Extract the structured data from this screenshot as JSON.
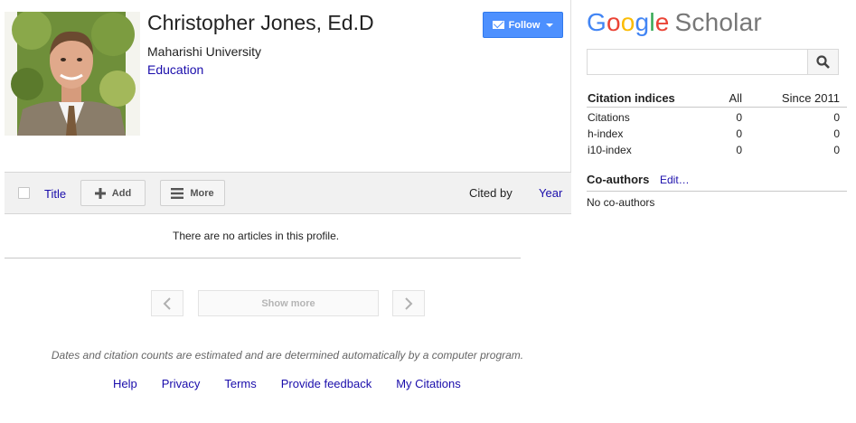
{
  "profile": {
    "name": "Christopher Jones, Ed.D",
    "affiliation": "Maharishi University",
    "interest": "Education",
    "follow_label": "Follow"
  },
  "toolbar": {
    "title_label": "Title",
    "add_label": "Add",
    "more_label": "More",
    "cited_by_label": "Cited by",
    "year_label": "Year"
  },
  "articles": {
    "empty_message": "There are no articles in this profile.",
    "show_more_label": "Show more"
  },
  "disclaimer": "Dates and citation counts are estimated and are determined automatically by a computer program.",
  "footer": {
    "links": [
      "Help",
      "Privacy",
      "Terms",
      "Provide feedback",
      "My Citations"
    ]
  },
  "sidebar": {
    "logo_google": "Google",
    "logo_scholar": "Scholar",
    "search": {
      "value": "",
      "placeholder": ""
    },
    "citation_indices": {
      "title": "Citation indices",
      "col_all": "All",
      "col_since": "Since 2011",
      "rows": [
        {
          "label": "Citations",
          "all": "0",
          "since": "0"
        },
        {
          "label": "h-index",
          "all": "0",
          "since": "0"
        },
        {
          "label": "i10-index",
          "all": "0",
          "since": "0"
        }
      ]
    },
    "coauthors": {
      "title": "Co-authors",
      "edit_label": "Edit…",
      "empty_message": "No co-authors"
    }
  },
  "colors": {
    "link": "#1a0dab",
    "follow_button": "#4d90fe",
    "toolbar_bg": "#f1f1f1"
  },
  "icons": [
    "mail-icon",
    "dropdown-caret-icon",
    "plus-icon",
    "menu-icon",
    "chevron-left-icon",
    "chevron-right-icon",
    "search-icon"
  ]
}
